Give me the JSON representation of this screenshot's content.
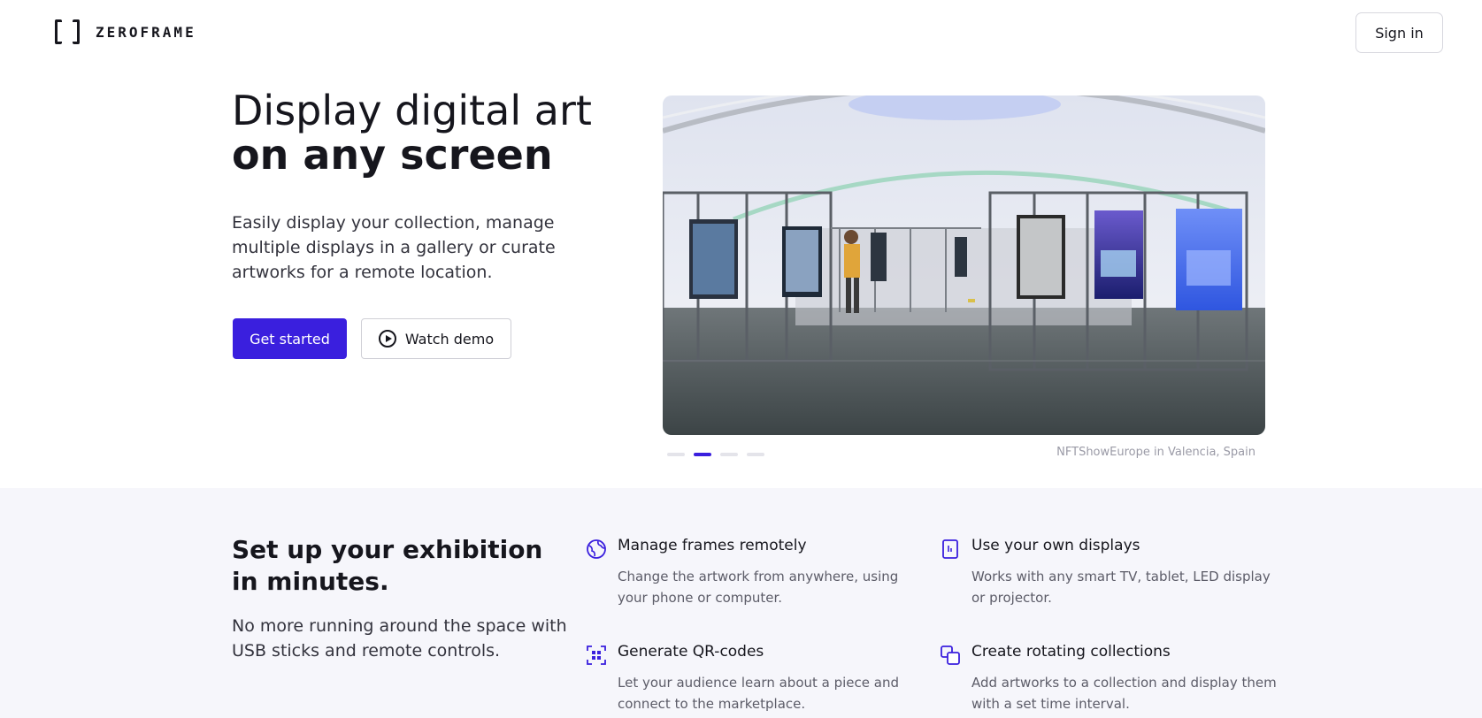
{
  "header": {
    "brand": "ZEROFRAME",
    "sign_in": "Sign in"
  },
  "hero": {
    "title_line1": "Display digital art",
    "title_line2": "on any screen",
    "description": "Easily display your collection, manage multiple displays in a gallery or curate artworks for a remote location.",
    "primary_cta": "Get started",
    "secondary_cta": "Watch demo",
    "photo_caption": "NFTShowEurope in Valencia, Spain",
    "carousel": {
      "total_slides": 4,
      "active_slide": 2
    }
  },
  "features": {
    "title": "Set up your exhibition in minutes.",
    "description": "No more running around the space with USB sticks and remote controls.",
    "items": [
      {
        "icon": "globe-icon",
        "name": "Manage frames remotely",
        "text": "Change the artwork from anywhere, using your phone or computer."
      },
      {
        "icon": "display-icon",
        "name": "Use your own displays",
        "text": "Works with any smart TV, tablet, LED display or projector."
      },
      {
        "icon": "qr-code-icon",
        "name": "Generate QR-codes",
        "text": "Let your audience learn about a piece and connect to the marketplace."
      },
      {
        "icon": "stacked-squares-icon",
        "name": "Create rotating collections",
        "text": "Add artworks to a collection and display them with a set time interval."
      }
    ]
  },
  "colors": {
    "accent": "#3a1fde",
    "text": "#16161d",
    "feature_bg": "#f6f6fb"
  }
}
